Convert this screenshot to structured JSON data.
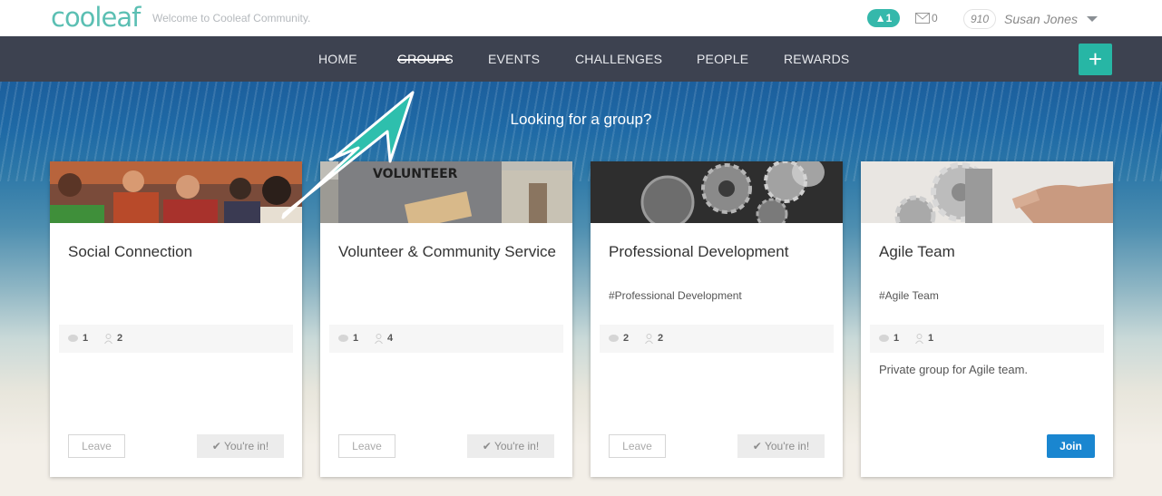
{
  "header": {
    "logo": "cooleaf",
    "welcome": "Welcome to Cooleaf Community.",
    "notification_count": "1",
    "message_count": "0",
    "points": "910",
    "user_name": "Susan Jones"
  },
  "nav": {
    "items": [
      "HOME",
      "GROUPS",
      "EVENTS",
      "CHALLENGES",
      "PEOPLE",
      "REWARDS"
    ],
    "active": "GROUPS",
    "add_label": "+"
  },
  "hero": {
    "title": "Looking for a group?"
  },
  "cards": [
    {
      "title": "Social Connection",
      "tag": "",
      "comments": "1",
      "members": "2",
      "description": "",
      "leave_label": "Leave",
      "status_label": "You're in!"
    },
    {
      "title": "Volunteer & Community Service",
      "tag": "",
      "comments": "1",
      "members": "4",
      "description": "",
      "leave_label": "Leave",
      "status_label": "You're in!"
    },
    {
      "title": "Professional Development",
      "tag": "#Professional Development",
      "comments": "2",
      "members": "2",
      "description": "",
      "leave_label": "Leave",
      "status_label": "You're in!"
    },
    {
      "title": "Agile Team",
      "tag": "#Agile Team",
      "comments": "1",
      "members": "1",
      "description": "Private group for Agile team.",
      "join_label": "Join"
    }
  ],
  "colors": {
    "accent": "#27b6a5",
    "nav_bg": "#3d4250",
    "join_blue": "#1a86d0"
  },
  "icons": [
    "bell-icon",
    "envelope-icon",
    "caret-down-icon",
    "plus-icon",
    "comment-icon",
    "person-icon",
    "check-icon",
    "annotation-arrow-icon"
  ]
}
